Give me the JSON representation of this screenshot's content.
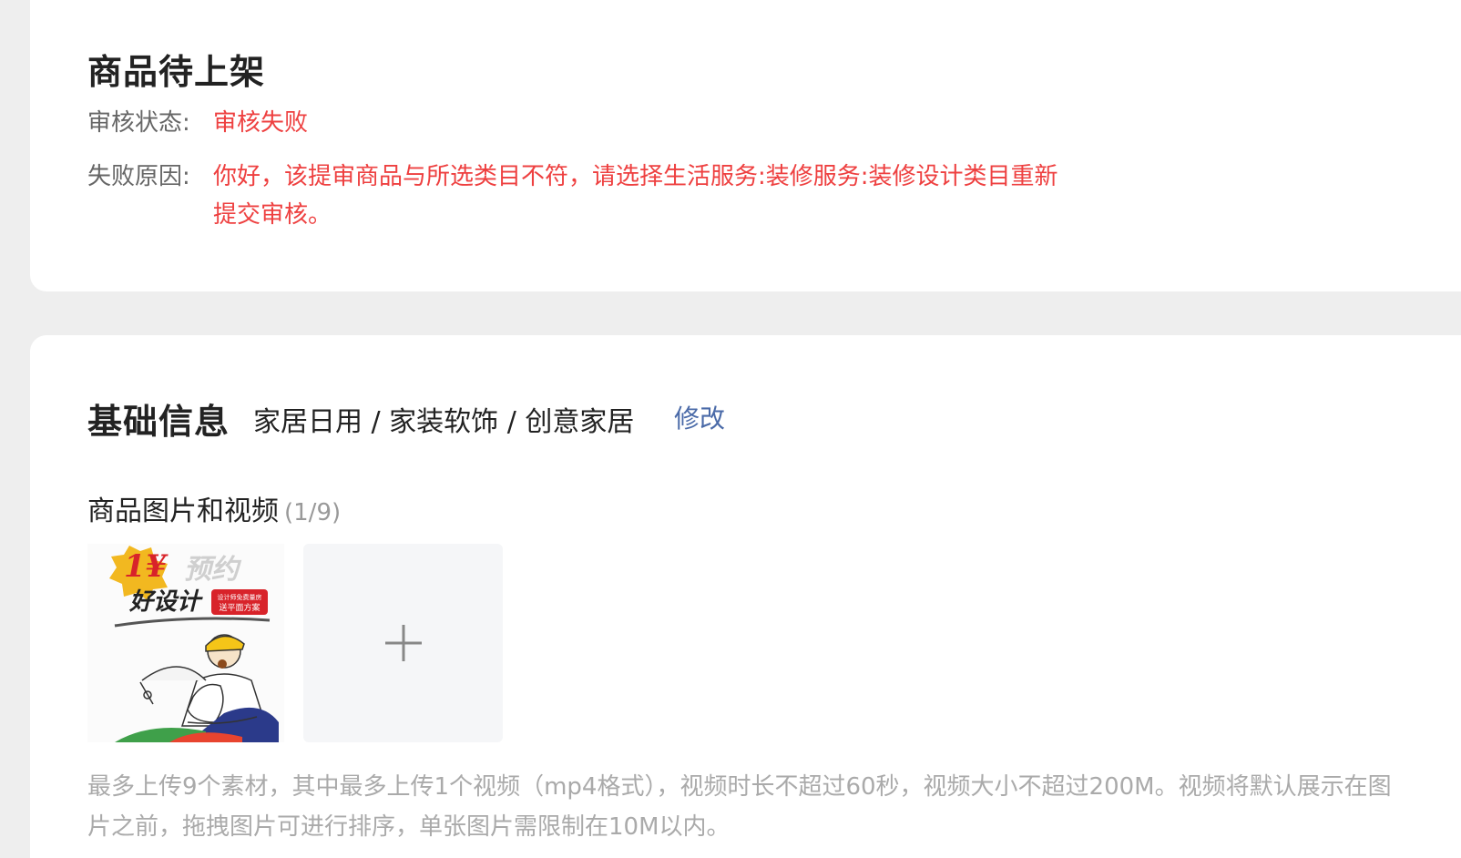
{
  "review": {
    "title": "商品待上架",
    "status_label": "审核状态:",
    "status_value": "审核失败",
    "reason_label": "失败原因:",
    "reason_value": "你好，该提审商品与所选类目不符，请选择生活服务:装修服务:装修设计类目重新提交审核。"
  },
  "basic": {
    "title": "基础信息",
    "category": "家居日用 / 家装软饰 / 创意家居",
    "edit_label": "修改"
  },
  "media": {
    "title": "商品图片和视频",
    "count": "(1/9)",
    "thumbnail": {
      "price_text": "1¥",
      "promo_text": "预约",
      "headline": "好设计",
      "badge_line1": "设计师免费量房",
      "badge_line2": "送平面方案"
    },
    "add_icon": "plus-icon",
    "hint": "最多上传9个素材，其中最多上传1个视频（mp4格式），视频时长不超过60秒，视频大小不超过200M。视频将默认展示在图片之前，拖拽图片可进行排序，单张图片需限制在10M以内。"
  },
  "colors": {
    "error": "#ee4040",
    "link": "#4a6aa8",
    "muted": "#999999",
    "background": "#eeeeee"
  }
}
